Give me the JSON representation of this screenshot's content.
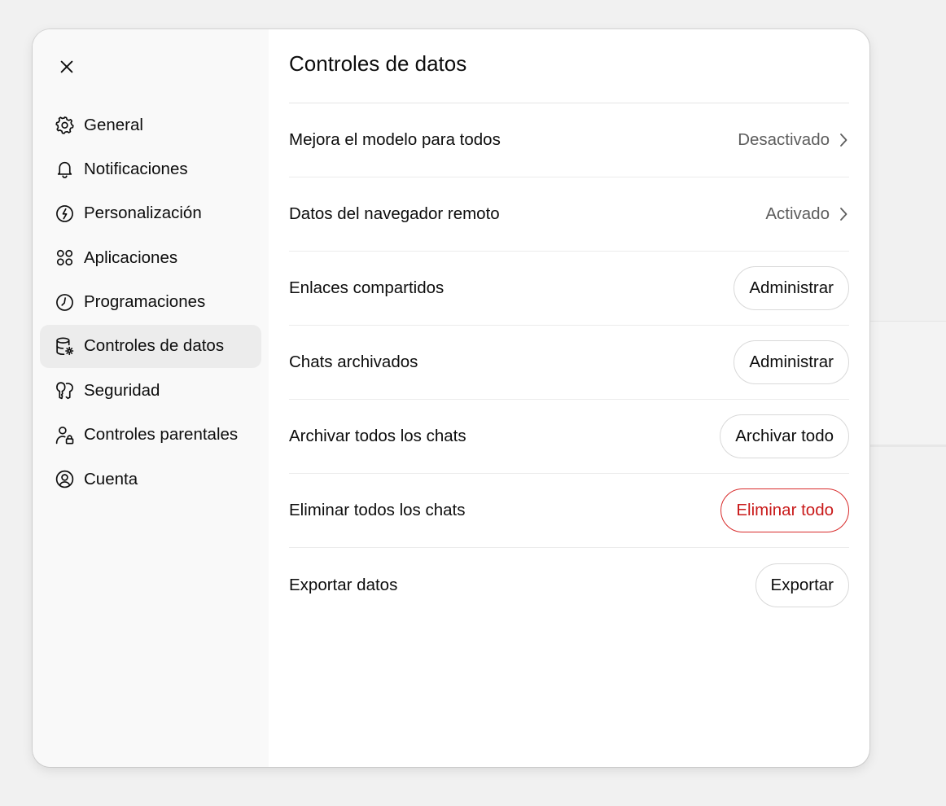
{
  "colors": {
    "backdrop": "#f1f1f1",
    "sidebar_bg": "#f9f9f9",
    "active_item_bg": "#ececec",
    "text": "#0d0d0d",
    "muted_text": "#5d5d5d",
    "danger": "#c91a1a"
  },
  "dialog": {
    "close_icon": "close-icon"
  },
  "sidebar": {
    "items": [
      {
        "label": "General",
        "icon": "gear-icon",
        "active": false
      },
      {
        "label": "Notificaciones",
        "icon": "bell-icon",
        "active": false
      },
      {
        "label": "Personalización",
        "icon": "personalization-icon",
        "active": false
      },
      {
        "label": "Aplicaciones",
        "icon": "apps-grid-icon",
        "active": false
      },
      {
        "label": "Programaciones",
        "icon": "clock-icon",
        "active": false
      },
      {
        "label": "Controles de datos",
        "icon": "database-gear-icon",
        "active": true
      },
      {
        "label": "Seguridad",
        "icon": "shield-key-icon",
        "active": false
      },
      {
        "label": "Controles parentales",
        "icon": "user-lock-icon",
        "active": false
      },
      {
        "label": "Cuenta",
        "icon": "user-circle-icon",
        "active": false
      }
    ]
  },
  "main": {
    "title": "Controles de datos",
    "rows": [
      {
        "label": "Mejora el modelo para todos",
        "value": "Desactivado",
        "control": "chevron-link"
      },
      {
        "label": "Datos del navegador remoto",
        "value": "Activado",
        "control": "chevron-link"
      },
      {
        "label": "Enlaces compartidos",
        "button": "Administrar",
        "control": "button"
      },
      {
        "label": "Chats archivados",
        "button": "Administrar",
        "control": "button"
      },
      {
        "label": "Archivar todos los chats",
        "button": "Archivar todo",
        "control": "button"
      },
      {
        "label": "Eliminar todos los chats",
        "button": "Eliminar todo",
        "control": "danger-button"
      },
      {
        "label": "Exportar datos",
        "button": "Exportar",
        "control": "button"
      }
    ]
  }
}
